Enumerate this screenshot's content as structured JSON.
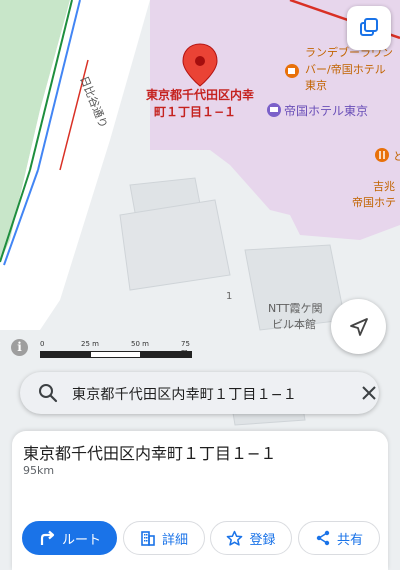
{
  "map": {
    "pin_label_line1": "東京都千代田区内幸",
    "pin_label_line2": "町１丁目１−１",
    "poi_restaurant_line1": "ランデブーラウン",
    "poi_restaurant_line2": "バー/帝国ホテル",
    "poi_restaurant_line3": "東京",
    "poi_hotel": "帝国ホテル東京",
    "poi_right_line1": "吉兆",
    "poi_right_line2": "帝国ホテ",
    "poi_building_line1": "NTT霞ケ関",
    "poi_building_line2": "ビル本館",
    "road_label": "日比谷通り",
    "block_number": "1",
    "partial_label": "と",
    "colors": {
      "pin": "#ea4335",
      "poi_orange": "#e8710a",
      "poi_hotel": "#7b61c9",
      "highlight_area": "#e7d6ec",
      "park": "#c8e6c9",
      "road_green": "#1e8e3e",
      "road_blue": "#4285f4",
      "road_red": "#d93025"
    }
  },
  "scale": {
    "ticks": [
      "0",
      "25 m",
      "50 m",
      "75 m"
    ]
  },
  "search": {
    "query": "東京都千代田区内幸町１丁目１−１"
  },
  "sheet": {
    "title": "東京都千代田区内幸町１丁目１−１",
    "distance": "95km",
    "buttons": {
      "route": "ルート",
      "details": "詳細",
      "save": "登録",
      "share": "共有"
    }
  },
  "icons": {
    "layers": "layers-icon",
    "locate": "navigation-arrow-icon",
    "info": "info-icon",
    "search": "search-icon",
    "close": "close-icon",
    "route": "turn-right-arrow-icon",
    "details": "building-icon",
    "save": "star-outline-icon",
    "share": "share-icon"
  },
  "accent_color": "#1a73e8"
}
